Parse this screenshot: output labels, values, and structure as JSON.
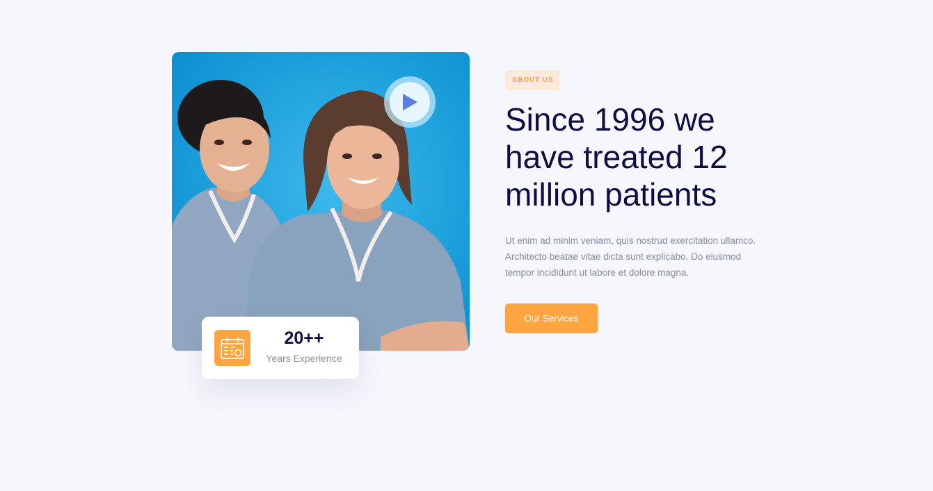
{
  "about": {
    "tag": "ABOUT US",
    "heading": "Since 1996 we have treated 12 million patients",
    "description": "Ut enim ad minim veniam, quis nostrud exercitation ullamco. Architecto beatae vitae dicta sunt explicabo. Do eiusmod tempor incididunt ut labore et dolore magna.",
    "cta_label": "Our Services"
  },
  "experience": {
    "number": "20++",
    "label": "Years Experience",
    "icon": "calendar-icon"
  },
  "media": {
    "image": "two-smiling-nurses-photo",
    "play_icon": "play-icon"
  },
  "colors": {
    "background": "#f6f7fc",
    "heading": "#0f0b45",
    "accent": "#ffa53f",
    "tag_background": "#fbeadc",
    "tag_text": "#f2a24e",
    "body_text": "#858a9d",
    "play_triangle": "#5b7be6"
  }
}
